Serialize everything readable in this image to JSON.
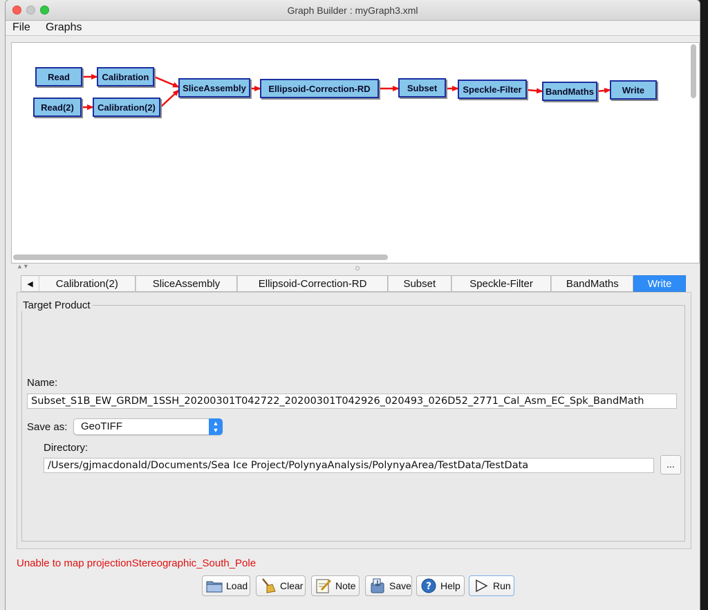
{
  "window": {
    "title": "Graph Builder : myGraph3.xml"
  },
  "menu": {
    "file": "File",
    "graphs": "Graphs"
  },
  "graph": {
    "nodes": [
      {
        "id": "read",
        "label": "Read"
      },
      {
        "id": "calibration",
        "label": "Calibration"
      },
      {
        "id": "read2",
        "label": "Read(2)"
      },
      {
        "id": "calibration2",
        "label": "Calibration(2)"
      },
      {
        "id": "sliceassembly",
        "label": "SliceAssembly"
      },
      {
        "id": "ellipsoid",
        "label": "Ellipsoid-Correction-RD"
      },
      {
        "id": "subset",
        "label": "Subset"
      },
      {
        "id": "speckle",
        "label": "Speckle-Filter"
      },
      {
        "id": "bandmaths",
        "label": "BandMaths"
      },
      {
        "id": "write",
        "label": "Write"
      }
    ],
    "edge_color": "#ee1111",
    "node_color": "#86c6ea"
  },
  "tabs": {
    "scroll_icon": "left-triangle-icon",
    "items": [
      {
        "label": "Calibration(2)"
      },
      {
        "label": "SliceAssembly"
      },
      {
        "label": "Ellipsoid-Correction-RD"
      },
      {
        "label": "Subset"
      },
      {
        "label": "Speckle-Filter"
      },
      {
        "label": "BandMaths"
      },
      {
        "label": "Write",
        "active": true
      }
    ]
  },
  "target_product": {
    "title": "Target Product",
    "name_label": "Name:",
    "name_value": "Subset_S1B_EW_GRDM_1SSH_20200301T042722_20200301T042926_020493_026D52_2771_Cal_Asm_EC_Spk_BandMath",
    "save_as_label": "Save as:",
    "save_as_value": "GeoTIFF",
    "directory_label": "Directory:",
    "directory_value": "/Users/gjmacdonald/Documents/Sea Ice Project/PolynyaAnalysis/PolynyaArea/TestData/TestData",
    "browse_label": "..."
  },
  "status": {
    "error": "Unable to map projectionStereographic_South_Pole",
    "error_color": "#e01010"
  },
  "buttons": {
    "load": "Load",
    "clear": "Clear",
    "note": "Note",
    "save": "Save",
    "help": "Help",
    "run": "Run"
  }
}
